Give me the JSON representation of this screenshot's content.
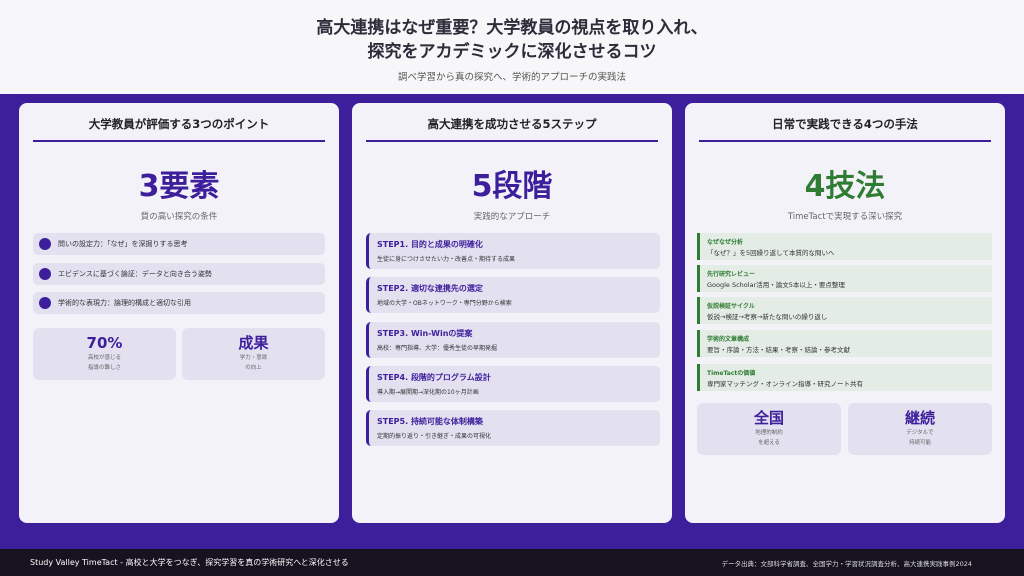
{
  "header": {
    "title_line1": "高大連携はなぜ重要？大学教員の視点を取り入れ、",
    "title_line2": "探究をアカデミックに深化させるコツ",
    "subtitle": "調べ学習から真の探究へ、学術的アプローチの実践法"
  },
  "card1": {
    "title": "大学教員が評価する3つのポイント",
    "big": "3要素",
    "big_sub": "質の高い探究の条件",
    "bullets": [
      "問いの設定力：「なぜ」を深掘りする思考",
      "エビデンスに基づく論証：データと向き合う姿勢",
      "学術的な表現力：論理的構成と適切な引用"
    ],
    "stats": [
      {
        "value": "70%",
        "line1": "高校が感じる",
        "line2": "指導の難しさ"
      },
      {
        "value": "成果",
        "line1": "学力・意欲",
        "line2": "の向上"
      }
    ]
  },
  "card2": {
    "title": "高大連携を成功させる5ステップ",
    "big": "5段階",
    "big_sub": "実践的なアプローチ",
    "steps": [
      {
        "head": "STEP1. 目的と成果の明確化",
        "desc": "生徒に身につけさせたい力・改善点・期待する成果"
      },
      {
        "head": "STEP2. 適切な連携先の選定",
        "desc": "地域の大学・OBネットワーク・専門分野から検索"
      },
      {
        "head": "STEP3. Win-Winの提案",
        "desc": "高校：専門指導、大学：優秀生徒の早期発掘"
      },
      {
        "head": "STEP4. 段階的プログラム設計",
        "desc": "導入期→展開期→深化期の10ヶ月計画"
      },
      {
        "head": "STEP5. 持続可能な体制構築",
        "desc": "定期的振り返り・引き継ぎ・成果の可視化"
      }
    ]
  },
  "card3": {
    "title": "日常で実践できる4つの手法",
    "big": "4技法",
    "big_sub": "TimeTactで実現する深い探究",
    "methods": [
      {
        "head": "なぜなぜ分析",
        "desc": "「なぜ？」を5回繰り返して本質的な問いへ"
      },
      {
        "head": "先行研究レビュー",
        "desc": "Google Scholar活用・論文5本以上・要点整理"
      },
      {
        "head": "仮説検証サイクル",
        "desc": "仮説→検証→考察→新たな問いの繰り返し"
      },
      {
        "head": "学術的文章構成",
        "desc": "要旨・序論・方法・結果・考察・結論・参考文献"
      },
      {
        "head": "TimeTactの価値",
        "desc": "専門家マッチング・オンライン指導・研究ノート共有"
      }
    ],
    "stats": [
      {
        "value": "全国",
        "line1": "地理的制約",
        "line2": "を超える"
      },
      {
        "value": "継続",
        "line1": "デジタルで",
        "line2": "持続可能"
      }
    ]
  },
  "footer": {
    "left": "Study Valley TimeTact - 高校と大学をつなぎ、探究学習を真の学術研究へと深化させる",
    "right": "データ出典：文部科学省調査、全国学力・学習状況調査分析、高大連携実践事例2024"
  },
  "colors": {
    "accent": "#3d1f9c",
    "green": "#2e7d32",
    "footer_bg": "#16121f"
  }
}
